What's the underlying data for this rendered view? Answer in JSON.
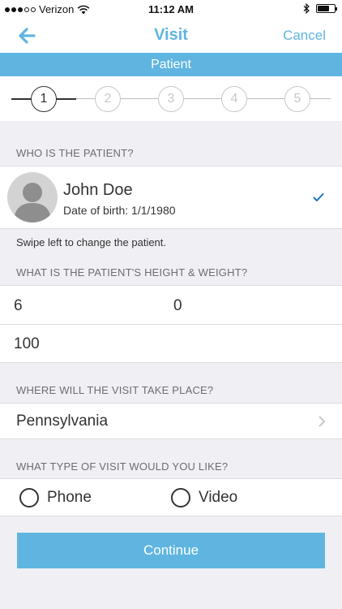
{
  "status_bar": {
    "carrier": "Verizon",
    "time": "11:12 AM"
  },
  "nav": {
    "title": "Visit",
    "cancel_label": "Cancel",
    "back_icon": "back-arrow-icon"
  },
  "section_banner": "Patient",
  "stepper": {
    "steps": [
      "1",
      "2",
      "3",
      "4",
      "5"
    ],
    "active_step": 1
  },
  "patient_section": {
    "label": "WHO IS THE PATIENT?",
    "name": "John Doe",
    "dob": "Date of birth: 1/1/1980",
    "hint": "Swipe left to change the patient."
  },
  "height_weight": {
    "label": "WHAT IS THE PATIENT'S HEIGHT & WEIGHT?",
    "feet": "6",
    "inches": "0",
    "weight": "100"
  },
  "location": {
    "label": "WHERE WILL THE VISIT TAKE PLACE?",
    "value": "Pennsylvania"
  },
  "visit_type": {
    "label": "WHAT TYPE OF VISIT WOULD YOU LIKE?",
    "options": [
      "Phone",
      "Video"
    ]
  },
  "continue_label": "Continue",
  "colors": {
    "accent": "#5fb5e0",
    "background": "#efeff4",
    "check": "#1a73c9"
  }
}
